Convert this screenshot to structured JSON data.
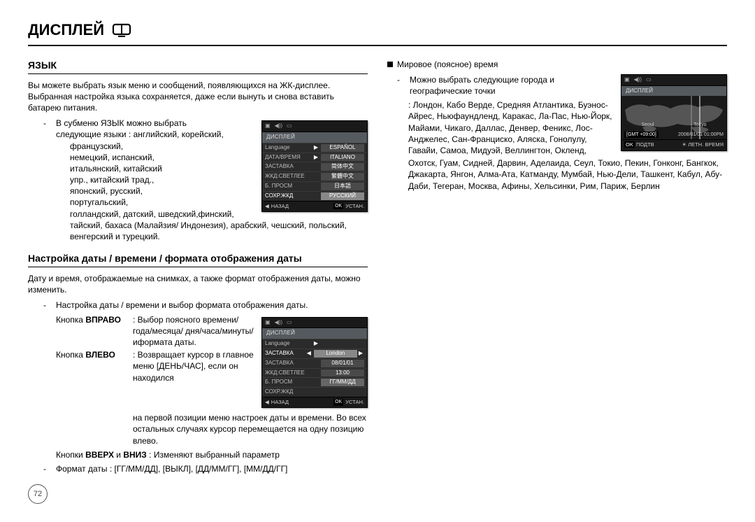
{
  "page_title": "ДИСПЛЕЙ",
  "page_number": "72",
  "left": {
    "lang_heading": "ЯЗЫК",
    "lang_p1": "Вы можете выбрать язык меню и сообщений, появляющихся на ЖК-дисплее. Выбранная настройка языка сохраняется, даже если вынуть и снова вставить батарею питания.",
    "lang_bullet_lead": "В субменю ЯЗЫК можно выбрать",
    "lang_bullet_line": "следующие языки : английский, корейский,",
    "lang_lines": [
      "французский,",
      "немецкий, испанский,",
      "итальянский, китайский",
      "упр., китайский трад.,",
      "японский, русский,",
      "португальский,"
    ],
    "lang_tail": "голландский, датский, шведский,финский,  тайский, бахаса (Малайзия/ Индонезия),  арабский, чешский,  польский,  венгерский  и  турецкий.",
    "lcd1": {
      "header": "ДИСПЛЕЙ",
      "rows": [
        {
          "label": "Language",
          "value": "ESPAÑOL"
        },
        {
          "label": "ДАТА/ВРЕМЯ",
          "value": "ITALIANO"
        },
        {
          "label": "ЗАСТАВКА",
          "value": "简体中文"
        },
        {
          "label": "ЖКД:СВЕТЛЕЕ",
          "value": "繁體中文"
        },
        {
          "label": "Б. ПРОСМ",
          "value": "日本語"
        },
        {
          "label": "СОХР.ЖКД",
          "value": "РУССКИЙ",
          "sel": true
        }
      ],
      "footer_back": "НАЗАД",
      "footer_ok": "OK",
      "footer_set": "УСТАН."
    },
    "dt_heading": "Настройка даты / времени / формата отображения даты",
    "dt_p1": "Дату и время, отображаемые на снимках, а также формат отображения даты, можно изменить.",
    "dt_bullet": "Настройка даты / времени и выбор формата отображения даты.",
    "dt_right_key": "Кнопка",
    "dt_right_label": "ВПРАВО",
    "dt_right_text": ": Выбор поясного времени/года/месяца/ дня/часа/минуты/ иформата даты.",
    "dt_left_label": "ВЛЕВО",
    "dt_left_text": ": Возвращает курсор в главное меню  [ДЕНЬ/ЧАС], если он находился",
    "dt_left_cont": "на первой позиции меню настроек даты и времени. Во всех остальных случаях курсор перемещается на одну позицию влево.",
    "dt_updown_lead": "Кнопки ",
    "dt_up": "ВВЕРХ",
    "dt_mid": " и ",
    "dt_down": "ВНИЗ",
    "dt_updown_text": " : Изменяют выбранный параметр",
    "dt_format_bullet": "Формат  даты : [ГГ/ММ/ДД],  [ВЫКЛ],  [ДД/ММ/ГГ],  [ММ/ДД/ГГ]",
    "lcd2": {
      "header": "ДИСПЛЕЙ",
      "rows": [
        {
          "label": "Language",
          "value": ""
        },
        {
          "label": "ЗАСТАВКА",
          "value": "London",
          "sel": true,
          "arrows": true
        },
        {
          "label": "ЗАСТАВКА",
          "value": "08/01/01"
        },
        {
          "label": "ЖКД:СВЕТЛЕЕ",
          "value": "13:00"
        },
        {
          "label": "Б. ПРОСМ",
          "value": "ГГ/ММ/ДД"
        },
        {
          "label": "СОХР.ЖКД",
          "value": ""
        }
      ],
      "footer_back": "НАЗАД",
      "footer_ok": "OK",
      "footer_set": "УСТАН."
    }
  },
  "right": {
    "world_heading": "Мировое (поясное) время",
    "world_bullet": "Можно выбрать следующие города и географические точки",
    "cities": ": Лондон, Кабо Верде, Средняя Атлантика, Буэнос-Айрес, Ньюфаундленд, Каракас, Ла-Пас, Нью-Йорк, Майами, Чикаго, Даллас, Денвер, Феникс, Лос-Анджелес, Сан-Франциско, Аляска, Гонолулу, Гавайи, Самоа, Мидуэй, Веллингтон, Окленд,",
    "cities2": "Охотск, Гуам, Сидней, Дарвин, Аделаида, Сеул, Токио, Пекин, Гонконг, Бангкок, Джакарта, Янгон, Алма-Ата, Катманду, Мумбай, Нью-Дели, Ташкент, Кабул, Абу-Даби, Тегеран, Москва, Афины, Хельсинки, Рим, Париж, Берлин",
    "lcd3": {
      "header": "ДИСПЛЕЙ",
      "city1": "Seoul",
      "city2": "Tokyo",
      "gmt": "[GMT +09:00]",
      "date": "2008/01/01  01:00PM",
      "footer_ok": "OK",
      "footer_confirm": "ПОДТВ",
      "footer_dst": "ЛЕТН. ВРЕМЯ"
    }
  }
}
